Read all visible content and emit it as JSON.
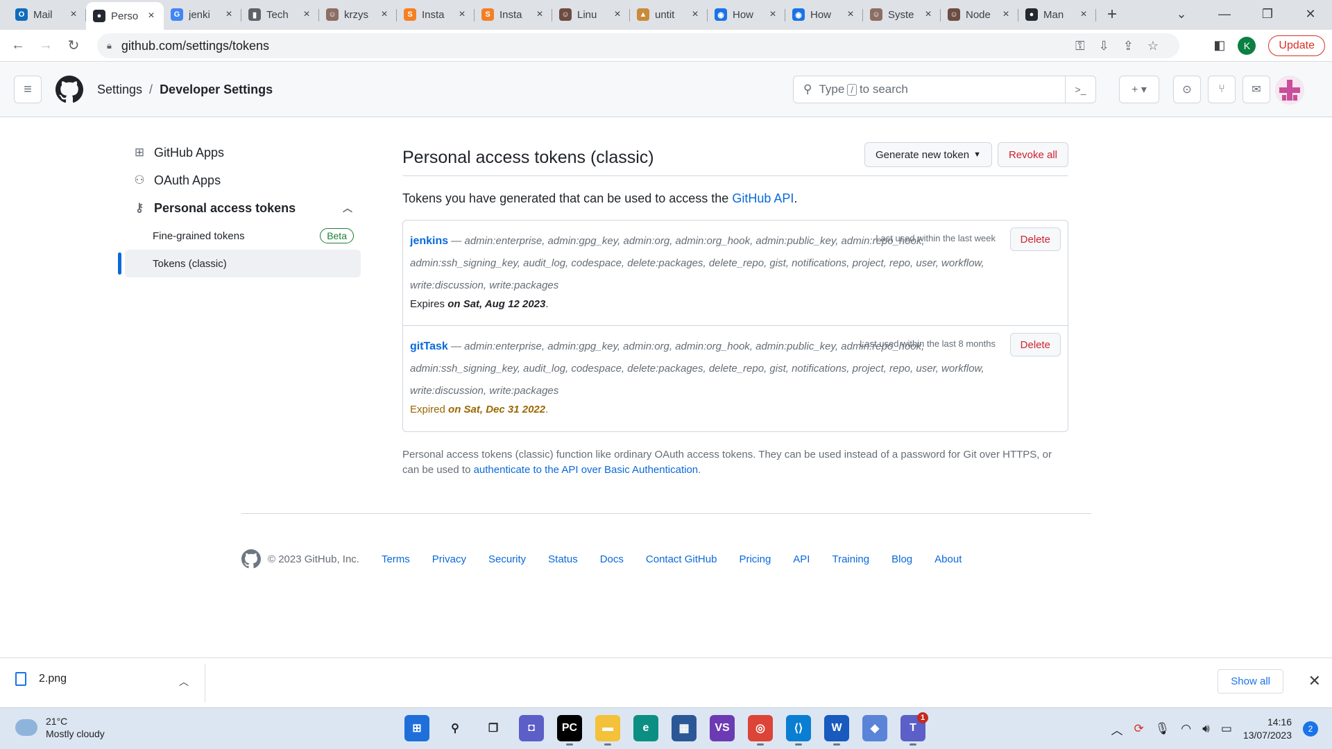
{
  "browser": {
    "tabs": [
      {
        "label": "Mail",
        "icon": "outlook-icon",
        "color": "#0f6cbd",
        "glyph": "O"
      },
      {
        "label": "Perso",
        "icon": "github-icon",
        "color": "#24292f",
        "glyph": "●",
        "active": true
      },
      {
        "label": "jenki",
        "icon": "google-icon",
        "color": "#4285f4",
        "glyph": "G"
      },
      {
        "label": "Tech",
        "icon": "book-icon",
        "color": "#5f6368",
        "glyph": "▮"
      },
      {
        "label": "krzys",
        "icon": "avatar-icon",
        "color": "#8d6e63",
        "glyph": "☺"
      },
      {
        "label": "Insta",
        "icon": "stackoverflow-icon",
        "color": "#f48024",
        "glyph": "S"
      },
      {
        "label": "Insta",
        "icon": "stackoverflow-icon",
        "color": "#f48024",
        "glyph": "S"
      },
      {
        "label": "Linu",
        "icon": "avatar-icon",
        "color": "#6d4c41",
        "glyph": "☺"
      },
      {
        "label": "untit",
        "icon": "image-icon",
        "color": "#c98a3a",
        "glyph": "▲"
      },
      {
        "label": "How",
        "icon": "chat-icon",
        "color": "#1a73e8",
        "glyph": "◉"
      },
      {
        "label": "How",
        "icon": "chat-icon",
        "color": "#1a73e8",
        "glyph": "◉"
      },
      {
        "label": "Syste",
        "icon": "avatar-icon",
        "color": "#8d6e63",
        "glyph": "☺"
      },
      {
        "label": "Node",
        "icon": "avatar-icon",
        "color": "#6d4c41",
        "glyph": "☺"
      },
      {
        "label": "Man",
        "icon": "github-icon",
        "color": "#24292f",
        "glyph": "●"
      }
    ],
    "url": "github.com/settings/tokens",
    "profile_initial": "K",
    "update_label": "Update"
  },
  "header": {
    "breadcrumb_root": "Settings",
    "breadcrumb_separator": "/",
    "breadcrumb_current": "Developer Settings",
    "search_prefix": "Type",
    "search_key": "/",
    "search_suffix": "to search"
  },
  "sidebar": {
    "items": [
      {
        "label": "GitHub Apps",
        "icon": "apps-grid-icon"
      },
      {
        "label": "OAuth Apps",
        "icon": "person-icon"
      },
      {
        "label": "Personal access tokens",
        "icon": "key-icon"
      }
    ],
    "sub_items": [
      {
        "label": "Fine-grained tokens",
        "badge": "Beta"
      },
      {
        "label": "Tokens (classic)",
        "selected": true
      }
    ]
  },
  "main": {
    "title": "Personal access tokens (classic)",
    "generate_label": "Generate new token",
    "revoke_label": "Revoke all",
    "intro_text": "Tokens you have generated that can be used to access the ",
    "intro_link": "GitHub API",
    "intro_end": ".",
    "tokens": [
      {
        "name": "jenkins",
        "scopes": " — admin:enterprise, admin:gpg_key, admin:org, admin:org_hook, admin:public_key, admin:repo_hook, admin:ssh_signing_key, audit_log, codespace, delete:packages, delete_repo, gist, notifications, project, repo, user, workflow, write:discussion, write:packages",
        "last_used": "Last used within the last week",
        "delete_label": "Delete",
        "expiry_prefix": "Expires",
        "expiry_date": "on Sat, Aug 12 2023",
        "expiry_end": "."
      },
      {
        "name": "gitTask",
        "scopes": " — admin:enterprise, admin:gpg_key, admin:org, admin:org_hook, admin:public_key, admin:repo_hook, admin:ssh_signing_key, audit_log, codespace, delete:packages, delete_repo, gist, notifications, project, repo, user, workflow, write:discussion, write:packages",
        "last_used": "Last used within the last 8 months",
        "delete_label": "Delete",
        "expiry_prefix": "Expired",
        "expiry_date": "on Sat, Dec 31 2022",
        "expiry_end": "."
      }
    ],
    "note_text": "Personal access tokens (classic) function like ordinary OAuth access tokens. They can be used instead of a password for Git over HTTPS, or can be used to ",
    "note_link": "authenticate to the API over Basic Authentication",
    "note_end": "."
  },
  "footer": {
    "copyright": "© 2023 GitHub, Inc.",
    "links": [
      "Terms",
      "Privacy",
      "Security",
      "Status",
      "Docs",
      "Contact GitHub",
      "Pricing",
      "API",
      "Training",
      "Blog",
      "About"
    ]
  },
  "downloads": {
    "file": "2.png",
    "show_all": "Show all"
  },
  "taskbar": {
    "temperature": "21°C",
    "condition": "Mostly cloudy",
    "apps": [
      {
        "name": "windows-start-icon",
        "color": "#1e6fd9",
        "glyph": "⊞",
        "running": false
      },
      {
        "name": "search-icon",
        "color": "#dce6f2",
        "glyph": "⚲",
        "running": false
      },
      {
        "name": "task-view-icon",
        "color": "#dce6f2",
        "glyph": "❐",
        "running": false
      },
      {
        "name": "teams-chat-icon",
        "color": "#5b5fc7",
        "glyph": "◘",
        "running": false
      },
      {
        "name": "pycharm-icon",
        "color": "#000000",
        "glyph": "PC",
        "running": true
      },
      {
        "name": "file-explorer-icon",
        "color": "#f3c13a",
        "glyph": "▬",
        "running": true
      },
      {
        "name": "edge-icon",
        "color": "#0c8f83",
        "glyph": "e",
        "running": false
      },
      {
        "name": "store-icon",
        "color": "#2b5797",
        "glyph": "▦",
        "running": false
      },
      {
        "name": "visual-studio-icon",
        "color": "#6c3bb4",
        "glyph": "VS",
        "running": false
      },
      {
        "name": "chrome-icon",
        "color": "#db4437",
        "glyph": "◎",
        "running": true
      },
      {
        "name": "vscode-icon",
        "color": "#0a7ed3",
        "glyph": "⟨⟩",
        "running": true
      },
      {
        "name": "word-icon",
        "color": "#185abd",
        "glyph": "W",
        "running": true
      },
      {
        "name": "sourcetree-icon",
        "color": "#5a84d8",
        "glyph": "◆",
        "running": false
      },
      {
        "name": "teams-icon",
        "color": "#5b5fc7",
        "glyph": "T",
        "running": true,
        "badge": "1"
      }
    ],
    "time": "14:16",
    "date": "13/07/2023",
    "notifications": "2"
  }
}
